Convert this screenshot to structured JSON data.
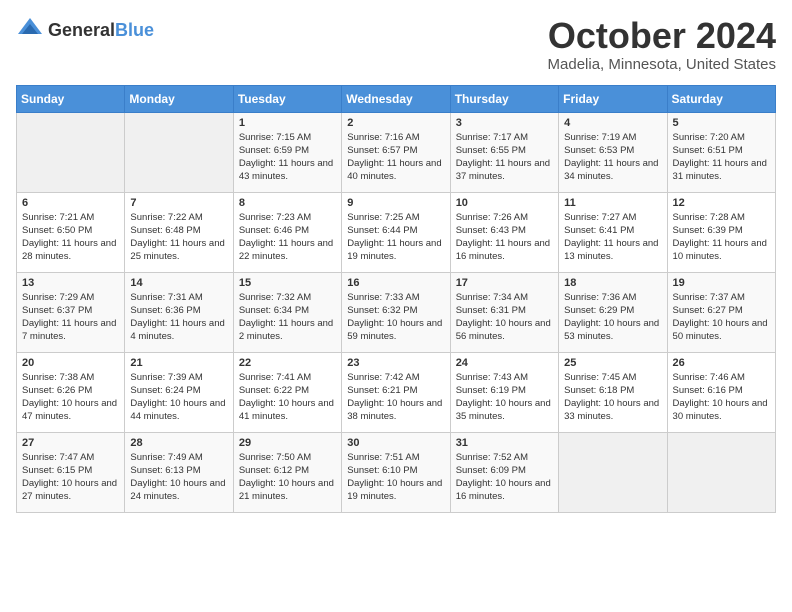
{
  "header": {
    "logo": {
      "general": "General",
      "blue": "Blue"
    },
    "title": "October 2024",
    "location": "Madelia, Minnesota, United States"
  },
  "weekdays": [
    "Sunday",
    "Monday",
    "Tuesday",
    "Wednesday",
    "Thursday",
    "Friday",
    "Saturday"
  ],
  "weeks": [
    [
      {
        "day": "",
        "sunrise": "",
        "sunset": "",
        "daylight": ""
      },
      {
        "day": "",
        "sunrise": "",
        "sunset": "",
        "daylight": ""
      },
      {
        "day": "1",
        "sunrise": "Sunrise: 7:15 AM",
        "sunset": "Sunset: 6:59 PM",
        "daylight": "Daylight: 11 hours and 43 minutes."
      },
      {
        "day": "2",
        "sunrise": "Sunrise: 7:16 AM",
        "sunset": "Sunset: 6:57 PM",
        "daylight": "Daylight: 11 hours and 40 minutes."
      },
      {
        "day": "3",
        "sunrise": "Sunrise: 7:17 AM",
        "sunset": "Sunset: 6:55 PM",
        "daylight": "Daylight: 11 hours and 37 minutes."
      },
      {
        "day": "4",
        "sunrise": "Sunrise: 7:19 AM",
        "sunset": "Sunset: 6:53 PM",
        "daylight": "Daylight: 11 hours and 34 minutes."
      },
      {
        "day": "5",
        "sunrise": "Sunrise: 7:20 AM",
        "sunset": "Sunset: 6:51 PM",
        "daylight": "Daylight: 11 hours and 31 minutes."
      }
    ],
    [
      {
        "day": "6",
        "sunrise": "Sunrise: 7:21 AM",
        "sunset": "Sunset: 6:50 PM",
        "daylight": "Daylight: 11 hours and 28 minutes."
      },
      {
        "day": "7",
        "sunrise": "Sunrise: 7:22 AM",
        "sunset": "Sunset: 6:48 PM",
        "daylight": "Daylight: 11 hours and 25 minutes."
      },
      {
        "day": "8",
        "sunrise": "Sunrise: 7:23 AM",
        "sunset": "Sunset: 6:46 PM",
        "daylight": "Daylight: 11 hours and 22 minutes."
      },
      {
        "day": "9",
        "sunrise": "Sunrise: 7:25 AM",
        "sunset": "Sunset: 6:44 PM",
        "daylight": "Daylight: 11 hours and 19 minutes."
      },
      {
        "day": "10",
        "sunrise": "Sunrise: 7:26 AM",
        "sunset": "Sunset: 6:43 PM",
        "daylight": "Daylight: 11 hours and 16 minutes."
      },
      {
        "day": "11",
        "sunrise": "Sunrise: 7:27 AM",
        "sunset": "Sunset: 6:41 PM",
        "daylight": "Daylight: 11 hours and 13 minutes."
      },
      {
        "day": "12",
        "sunrise": "Sunrise: 7:28 AM",
        "sunset": "Sunset: 6:39 PM",
        "daylight": "Daylight: 11 hours and 10 minutes."
      }
    ],
    [
      {
        "day": "13",
        "sunrise": "Sunrise: 7:29 AM",
        "sunset": "Sunset: 6:37 PM",
        "daylight": "Daylight: 11 hours and 7 minutes."
      },
      {
        "day": "14",
        "sunrise": "Sunrise: 7:31 AM",
        "sunset": "Sunset: 6:36 PM",
        "daylight": "Daylight: 11 hours and 4 minutes."
      },
      {
        "day": "15",
        "sunrise": "Sunrise: 7:32 AM",
        "sunset": "Sunset: 6:34 PM",
        "daylight": "Daylight: 11 hours and 2 minutes."
      },
      {
        "day": "16",
        "sunrise": "Sunrise: 7:33 AM",
        "sunset": "Sunset: 6:32 PM",
        "daylight": "Daylight: 10 hours and 59 minutes."
      },
      {
        "day": "17",
        "sunrise": "Sunrise: 7:34 AM",
        "sunset": "Sunset: 6:31 PM",
        "daylight": "Daylight: 10 hours and 56 minutes."
      },
      {
        "day": "18",
        "sunrise": "Sunrise: 7:36 AM",
        "sunset": "Sunset: 6:29 PM",
        "daylight": "Daylight: 10 hours and 53 minutes."
      },
      {
        "day": "19",
        "sunrise": "Sunrise: 7:37 AM",
        "sunset": "Sunset: 6:27 PM",
        "daylight": "Daylight: 10 hours and 50 minutes."
      }
    ],
    [
      {
        "day": "20",
        "sunrise": "Sunrise: 7:38 AM",
        "sunset": "Sunset: 6:26 PM",
        "daylight": "Daylight: 10 hours and 47 minutes."
      },
      {
        "day": "21",
        "sunrise": "Sunrise: 7:39 AM",
        "sunset": "Sunset: 6:24 PM",
        "daylight": "Daylight: 10 hours and 44 minutes."
      },
      {
        "day": "22",
        "sunrise": "Sunrise: 7:41 AM",
        "sunset": "Sunset: 6:22 PM",
        "daylight": "Daylight: 10 hours and 41 minutes."
      },
      {
        "day": "23",
        "sunrise": "Sunrise: 7:42 AM",
        "sunset": "Sunset: 6:21 PM",
        "daylight": "Daylight: 10 hours and 38 minutes."
      },
      {
        "day": "24",
        "sunrise": "Sunrise: 7:43 AM",
        "sunset": "Sunset: 6:19 PM",
        "daylight": "Daylight: 10 hours and 35 minutes."
      },
      {
        "day": "25",
        "sunrise": "Sunrise: 7:45 AM",
        "sunset": "Sunset: 6:18 PM",
        "daylight": "Daylight: 10 hours and 33 minutes."
      },
      {
        "day": "26",
        "sunrise": "Sunrise: 7:46 AM",
        "sunset": "Sunset: 6:16 PM",
        "daylight": "Daylight: 10 hours and 30 minutes."
      }
    ],
    [
      {
        "day": "27",
        "sunrise": "Sunrise: 7:47 AM",
        "sunset": "Sunset: 6:15 PM",
        "daylight": "Daylight: 10 hours and 27 minutes."
      },
      {
        "day": "28",
        "sunrise": "Sunrise: 7:49 AM",
        "sunset": "Sunset: 6:13 PM",
        "daylight": "Daylight: 10 hours and 24 minutes."
      },
      {
        "day": "29",
        "sunrise": "Sunrise: 7:50 AM",
        "sunset": "Sunset: 6:12 PM",
        "daylight": "Daylight: 10 hours and 21 minutes."
      },
      {
        "day": "30",
        "sunrise": "Sunrise: 7:51 AM",
        "sunset": "Sunset: 6:10 PM",
        "daylight": "Daylight: 10 hours and 19 minutes."
      },
      {
        "day": "31",
        "sunrise": "Sunrise: 7:52 AM",
        "sunset": "Sunset: 6:09 PM",
        "daylight": "Daylight: 10 hours and 16 minutes."
      },
      {
        "day": "",
        "sunrise": "",
        "sunset": "",
        "daylight": ""
      },
      {
        "day": "",
        "sunrise": "",
        "sunset": "",
        "daylight": ""
      }
    ]
  ]
}
